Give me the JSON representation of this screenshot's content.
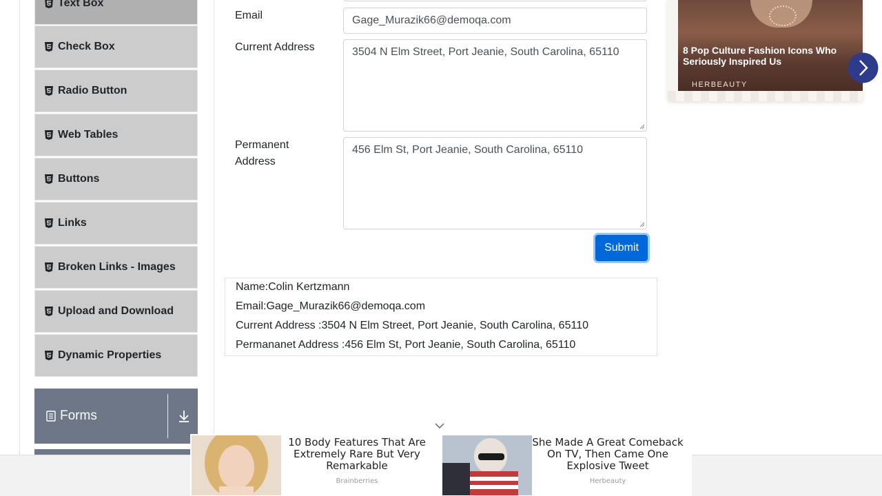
{
  "sidebar": {
    "items": [
      {
        "label": "Text Box",
        "active": true
      },
      {
        "label": "Check Box"
      },
      {
        "label": "Radio Button"
      },
      {
        "label": "Web Tables"
      },
      {
        "label": "Buttons"
      },
      {
        "label": "Links"
      },
      {
        "label": "Broken Links - Images"
      },
      {
        "label": "Upload and Download"
      },
      {
        "label": "Dynamic Properties"
      }
    ],
    "group": {
      "label": "Forms",
      "icon": "document-icon",
      "toggle_icon": "download-arrow-icon"
    }
  },
  "form": {
    "email": {
      "label": "Email",
      "value": "Gage_Murazik66@demoqa.com"
    },
    "current_address": {
      "label": "Current Address",
      "value": "3504 N Elm Street, Port Jeanie, South Carolina, 65110"
    },
    "permanent_address": {
      "label_line1": "Permanent",
      "label_line2": "Address",
      "value": "456 Elm St, Port Jeanie, South Carolina, 65110"
    },
    "submit_label": "Submit"
  },
  "output": {
    "name": "Name:Colin Kertzmann",
    "email": "Email:Gage_Murazik66@demoqa.com",
    "current_address": "Current Address :3504 N Elm Street, Port Jeanie, South Carolina, 65110",
    "permanent_address": "Permananet Address :456 Elm St, Port Jeanie, South Carolina, 65110"
  },
  "ads": {
    "top": {
      "headline": "8 Pop Culture Fashion Icons Who Seriously Inspired Us",
      "brand": "HERBEAUTY"
    },
    "bottom": [
      {
        "title": "10 Body Features That Are Extremely Rare But Very Remarkable",
        "source": "Brainberries"
      },
      {
        "title": "She Made A Great Comeback On TV, Then Came One Explosive Tweet",
        "source": "Herbeauty"
      }
    ]
  },
  "colors": {
    "submit": "#0069d9",
    "menu_item": "#cccccc",
    "group_header": "#6d7787",
    "ad_next_button": "#2e3a8c"
  }
}
